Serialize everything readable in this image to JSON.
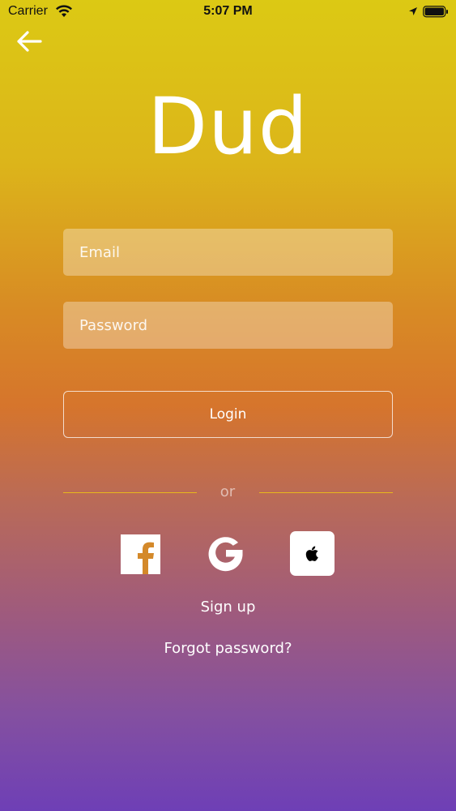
{
  "status_bar": {
    "carrier": "Carrier",
    "time": "5:07 PM"
  },
  "header": {
    "back_icon": "arrow-left-icon"
  },
  "logo": {
    "text": "Dud"
  },
  "form": {
    "email_placeholder": "Email",
    "email_value": "",
    "password_placeholder": "Password",
    "password_value": "",
    "login_label": "Login"
  },
  "divider": {
    "text": "or"
  },
  "social": {
    "icons": [
      "facebook-icon",
      "google-icon",
      "apple-icon"
    ]
  },
  "links": {
    "signup": "Sign up",
    "forgot_password": "Forgot password?"
  },
  "colors": {
    "gradient_top": "#dcc914",
    "gradient_middle": "#d6752c",
    "gradient_bottom": "#6e3fb6",
    "divider_line": "#e8b81c"
  }
}
